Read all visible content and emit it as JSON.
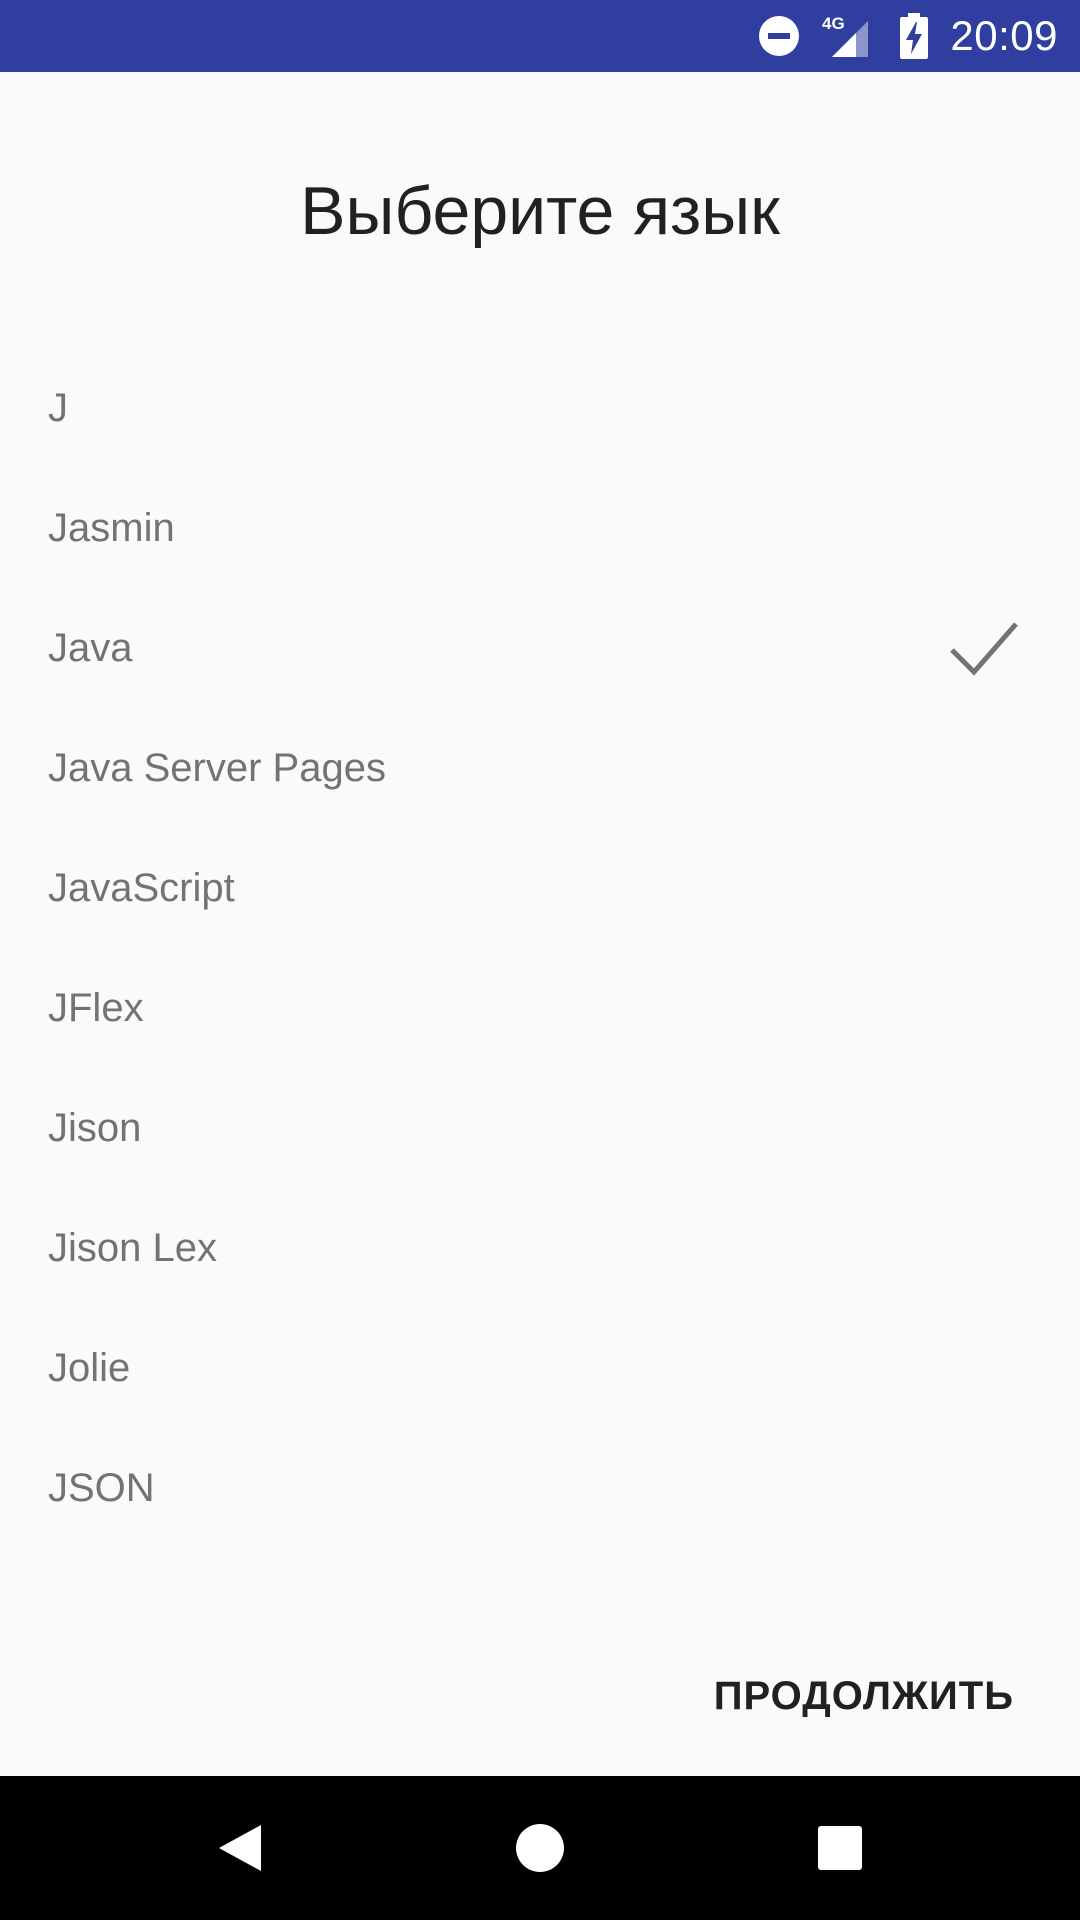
{
  "status_bar": {
    "network_label": "4G",
    "time": "20:09",
    "background_color": "#303f9f",
    "icons": [
      "do-not-disturb-icon",
      "signal-icon",
      "battery-charging-icon"
    ]
  },
  "screen": {
    "title": "Выберите язык"
  },
  "languages": [
    {
      "label": "J",
      "selected": false
    },
    {
      "label": "Jasmin",
      "selected": false
    },
    {
      "label": "Java",
      "selected": true
    },
    {
      "label": "Java Server Pages",
      "selected": false
    },
    {
      "label": "JavaScript",
      "selected": false
    },
    {
      "label": "JFlex",
      "selected": false
    },
    {
      "label": "Jison",
      "selected": false
    },
    {
      "label": "Jison Lex",
      "selected": false
    },
    {
      "label": "Jolie",
      "selected": false
    },
    {
      "label": "JSON",
      "selected": false
    }
  ],
  "actions": {
    "continue_label": "ПРОДОЛЖИТЬ"
  },
  "nav_bar": {
    "icons": [
      "back-icon",
      "home-icon",
      "recents-icon"
    ]
  }
}
